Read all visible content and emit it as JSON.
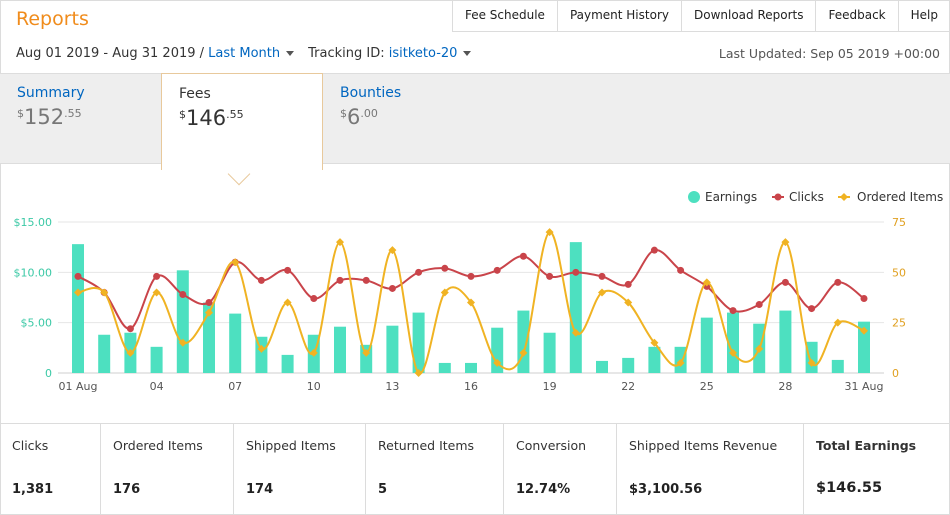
{
  "page_title": "Reports",
  "top_nav": [
    "Fee Schedule",
    "Payment History",
    "Download Reports",
    "Feedback",
    "Help"
  ],
  "filters": {
    "date_range": "Aug 01 2019 - Aug 31 2019 /",
    "period": "Last Month",
    "tracking_label": "Tracking ID:",
    "tracking_id": "isitketo-20"
  },
  "last_updated": "Last Updated: Sep 05 2019 +00:00",
  "tabs": [
    {
      "label": "Summary",
      "currency": "$",
      "amount": "152",
      "cents": ".55"
    },
    {
      "label": "Fees",
      "currency": "$",
      "amount": "146",
      "cents": ".55"
    },
    {
      "label": "Bounties",
      "currency": "$",
      "amount": "6",
      "cents": ".00"
    }
  ],
  "stats": [
    {
      "label": "Clicks",
      "value": "1,381"
    },
    {
      "label": "Ordered Items",
      "value": "176"
    },
    {
      "label": "Shipped Items",
      "value": "174"
    },
    {
      "label": "Returned Items",
      "value": "5"
    },
    {
      "label": "Conversion",
      "value": "12.74%"
    },
    {
      "label": "Shipped Items Revenue",
      "value": "$3,100.56"
    },
    {
      "label": "Total Earnings",
      "value": "$146.55"
    }
  ],
  "colors": {
    "accent": "#f08c1c",
    "link": "#0066c0",
    "earnings": "#4de0c0",
    "clicks": "#c9444a",
    "ordered": "#f0b323"
  },
  "chart_data": {
    "type": "bar",
    "x": [
      1,
      2,
      3,
      4,
      5,
      6,
      7,
      8,
      9,
      10,
      11,
      12,
      13,
      14,
      15,
      16,
      17,
      18,
      19,
      20,
      21,
      22,
      23,
      24,
      25,
      26,
      27,
      28,
      29,
      30,
      31
    ],
    "x_tick_labels": [
      "01 Aug",
      "04",
      "07",
      "10",
      "13",
      "16",
      "19",
      "22",
      "25",
      "28",
      "31 Aug"
    ],
    "x_tick_days": [
      1,
      4,
      7,
      10,
      13,
      16,
      19,
      22,
      25,
      28,
      31
    ],
    "y_left": {
      "ticks": [
        "$15.00",
        "$10.00",
        "$5.00",
        "0"
      ],
      "range": [
        0,
        15
      ]
    },
    "y_right": {
      "ticks": [
        "75",
        "50",
        "25",
        "0"
      ],
      "range": [
        0,
        75
      ]
    },
    "legend": {
      "position": "top-right",
      "items": [
        "Earnings",
        "Clicks",
        "Ordered Items"
      ]
    },
    "series": [
      {
        "name": "Earnings",
        "type": "bar",
        "axis": "left",
        "values": [
          12.8,
          3.8,
          4.0,
          2.6,
          10.2,
          7.0,
          5.9,
          3.6,
          1.8,
          3.8,
          4.6,
          2.8,
          4.7,
          6.0,
          1.0,
          1.0,
          4.5,
          6.2,
          4.0,
          13.0,
          1.2,
          1.5,
          2.6,
          2.6,
          5.5,
          6.0,
          4.9,
          6.2,
          3.1,
          1.3,
          5.1
        ]
      },
      {
        "name": "Clicks",
        "type": "line",
        "axis": "right",
        "values": [
          48,
          40,
          22,
          48,
          39,
          35,
          55,
          46,
          51,
          37,
          46,
          46,
          42,
          50,
          52,
          48,
          51,
          58,
          48,
          50,
          48,
          44,
          61,
          51,
          43,
          31,
          34,
          45,
          32,
          45,
          37
        ]
      },
      {
        "name": "Ordered Items",
        "type": "line",
        "axis": "right",
        "values": [
          40,
          40,
          10,
          40,
          15,
          30,
          55,
          12,
          35,
          10,
          65,
          10,
          61,
          0,
          40,
          35,
          5,
          10,
          70,
          20,
          40,
          35,
          15,
          5,
          45,
          10,
          12,
          65,
          5,
          25,
          21
        ]
      }
    ]
  }
}
